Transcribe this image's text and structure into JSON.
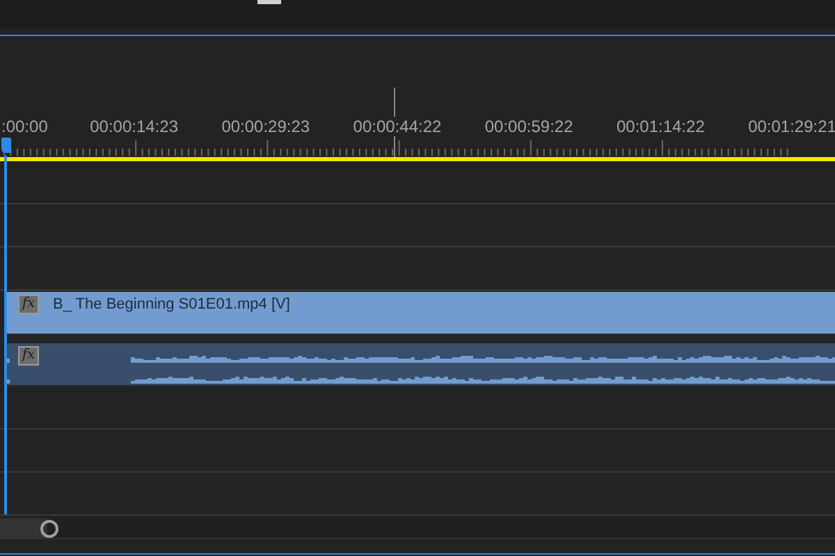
{
  "ruler": {
    "timecodes": [
      ":00:00",
      "00:00:14:23",
      "00:00:29:23",
      "00:00:44:22",
      "00:00:59:22",
      "00:01:14:22",
      "00:01:29:21"
    ]
  },
  "tracks": [
    {
      "kind": "empty"
    },
    {
      "kind": "empty"
    },
    {
      "kind": "empty"
    },
    {
      "kind": "video",
      "fx": "fx",
      "name": "B_ The Beginning S01E01.mp4 [V]"
    },
    {
      "kind": "audio",
      "fx": "fx"
    },
    {
      "kind": "empty"
    },
    {
      "kind": "empty"
    },
    {
      "kind": "empty"
    }
  ]
}
